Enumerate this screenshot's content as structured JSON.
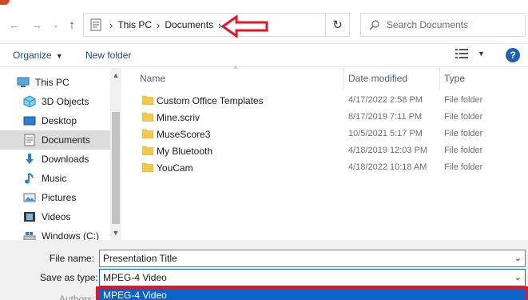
{
  "window": {
    "title": ""
  },
  "address_bar": {
    "segments": [
      "This PC",
      "Documents"
    ],
    "search_placeholder": "Search Documents"
  },
  "toolbar": {
    "organize_label": "Organize",
    "new_folder_label": "New folder",
    "help_label": "?"
  },
  "nav_pane": {
    "items": [
      {
        "label": "This PC",
        "icon": "pc-icon"
      },
      {
        "label": "3D Objects",
        "icon": "cube-icon"
      },
      {
        "label": "Desktop",
        "icon": "desktop-icon"
      },
      {
        "label": "Documents",
        "icon": "documents-icon",
        "selected": true
      },
      {
        "label": "Downloads",
        "icon": "download-arrow-icon"
      },
      {
        "label": "Music",
        "icon": "music-note-icon"
      },
      {
        "label": "Pictures",
        "icon": "pictures-icon"
      },
      {
        "label": "Videos",
        "icon": "film-icon"
      },
      {
        "label": "Windows (C:)",
        "icon": "drive-icon"
      }
    ]
  },
  "file_list": {
    "columns": [
      "Name",
      "Date modified",
      "Type"
    ],
    "rows": [
      {
        "name": "Custom Office Templates",
        "date": "4/17/2022 2:58 PM",
        "type": "File folder"
      },
      {
        "name": "Mine.scriv",
        "date": "8/17/2019 7:11 PM",
        "type": "File folder"
      },
      {
        "name": "MuseScore3",
        "date": "10/5/2021 5:17 PM",
        "type": "File folder"
      },
      {
        "name": "My Bluetooth",
        "date": "4/18/2019 12:03 PM",
        "type": "File folder"
      },
      {
        "name": "YouCam",
        "date": "4/18/2022 10:18 AM",
        "type": "File folder"
      }
    ]
  },
  "form": {
    "file_name_label": "File name:",
    "file_name_value": "Presentation Title",
    "save_as_type_label": "Save as type:",
    "save_as_type_value": "MPEG-4 Video",
    "dropdown_option": "MPEG-4 Video",
    "authors_label": "Authors:"
  },
  "colors": {
    "accent": "#0a64c8",
    "annotation_red": "#e0162b",
    "folder_yellow": "#f3c84b",
    "selected_bg": "#dcdcdc"
  }
}
